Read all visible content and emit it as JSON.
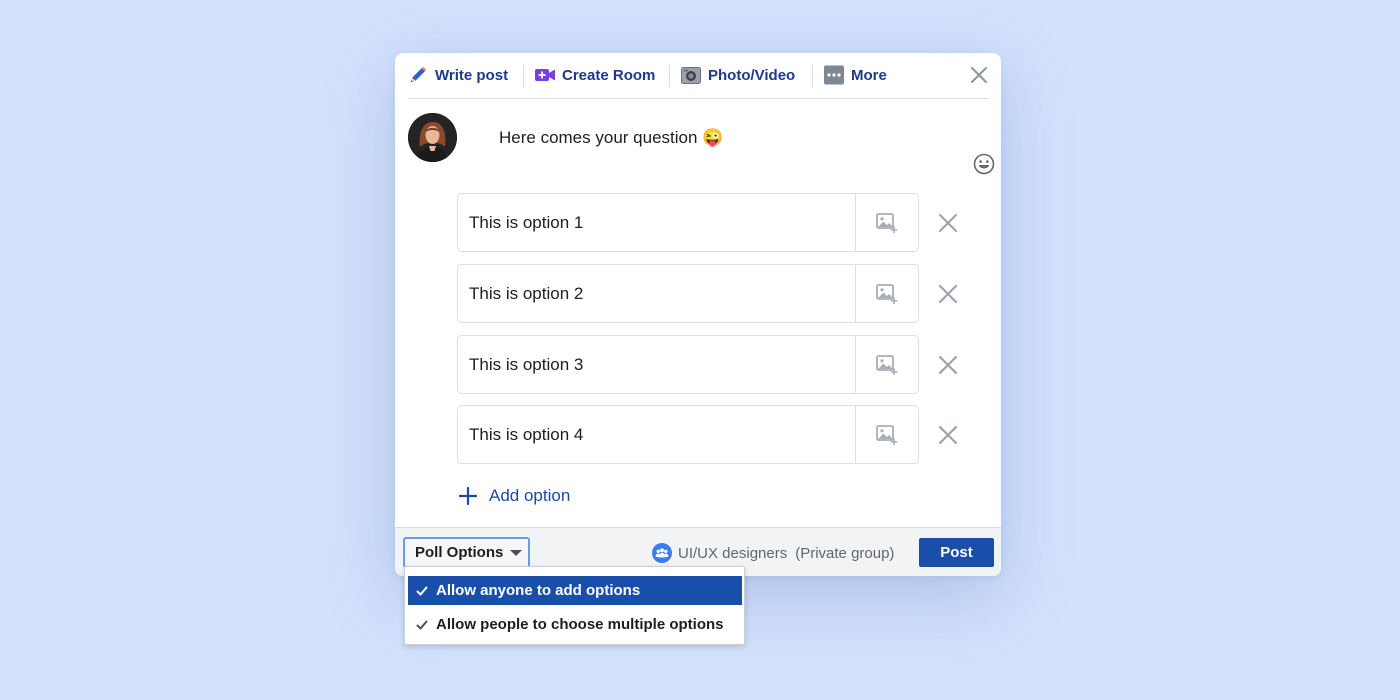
{
  "tabs": {
    "write_post": "Write post",
    "create_room": "Create Room",
    "photo_video": "Photo/Video",
    "more": "More"
  },
  "composer": {
    "question": "Here comes your question 😜"
  },
  "poll": {
    "options": [
      {
        "text": "This is option 1"
      },
      {
        "text": "This is option 2"
      },
      {
        "text": "This is option 3"
      },
      {
        "text": "This is option 4"
      }
    ],
    "add_option_label": "Add option"
  },
  "footer": {
    "poll_options_label": "Poll Options",
    "group_name": "UI/UX designers",
    "group_privacy": "(Private group)",
    "post_label": "Post"
  },
  "dropdown": {
    "items": [
      {
        "label": "Allow anyone to add options",
        "selected": true
      },
      {
        "label": "Allow people to choose multiple options",
        "selected": false
      }
    ]
  },
  "colors": {
    "background": "#d3e1fb",
    "accent": "#1a4eab",
    "tab_text": "#1d3a8a",
    "room_icon": "#7b3fe4"
  },
  "icons": {
    "write_post": "pencil-icon",
    "create_room": "video-plus-icon",
    "photo_video": "camera-icon",
    "more": "more-dots-icon",
    "close": "close-icon",
    "emoji": "smiley-icon",
    "add_image": "image-add-icon",
    "remove": "close-icon",
    "add": "plus-icon",
    "group": "group-icon",
    "caret": "caret-down-icon",
    "check": "check-icon"
  }
}
